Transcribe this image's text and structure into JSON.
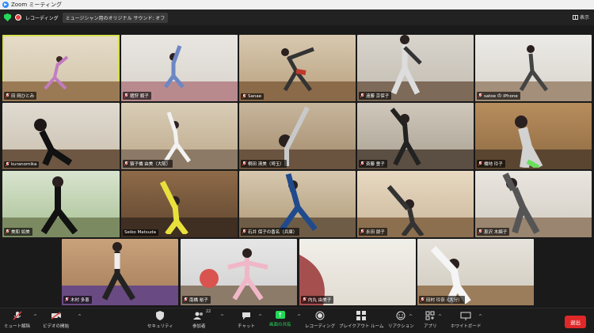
{
  "window": {
    "title": "Zoom ミーティング"
  },
  "infobar": {
    "recording_label": "レコーディング",
    "sound_chip": "ミュージシャン用のオリジナル サウンド: オフ",
    "view_label": "表示"
  },
  "participants": [
    {
      "name": "田 岡ひとみ",
      "active": true
    },
    {
      "name": "猪狩 順子"
    },
    {
      "name": "Sanae"
    },
    {
      "name": "遠藤 京保子"
    },
    {
      "name": "satoe の iPhone"
    },
    {
      "name": "kuranomika"
    },
    {
      "name": "猿子橋 由美（大阪）"
    },
    {
      "name": "桐田 清美（埼玉）"
    },
    {
      "name": "斉藤 豊子"
    },
    {
      "name": "橋地 玲子"
    },
    {
      "name": "美和 如美"
    },
    {
      "name": "Seiko Matsuda"
    },
    {
      "name": "石井 保子の香名（兵庫）"
    },
    {
      "name": "永田 朋子"
    },
    {
      "name": "恵沢 木綿子"
    },
    {
      "name": "木村 多恵"
    },
    {
      "name": "南橋 裕子"
    },
    {
      "name": "内丸 由美子"
    },
    {
      "name": "田村 玲奈（大分）"
    }
  ],
  "toolbar": {
    "mute": "ミュート解除",
    "video": "ビデオの開始",
    "security": "セキュリティ",
    "participants": "参加者",
    "participant_count": "22",
    "chat": "チャット",
    "share": "画面の共有",
    "record": "レコーディング",
    "breakout": "ブレイクアウト ルーム",
    "reactions": "リアクション",
    "apps": "アプリ",
    "whiteboard": "ホワイトボード",
    "leave": "退出"
  },
  "colors": {
    "accent_green": "#23d959",
    "leave_red": "#e02828",
    "active_border": "#d6e14c"
  }
}
